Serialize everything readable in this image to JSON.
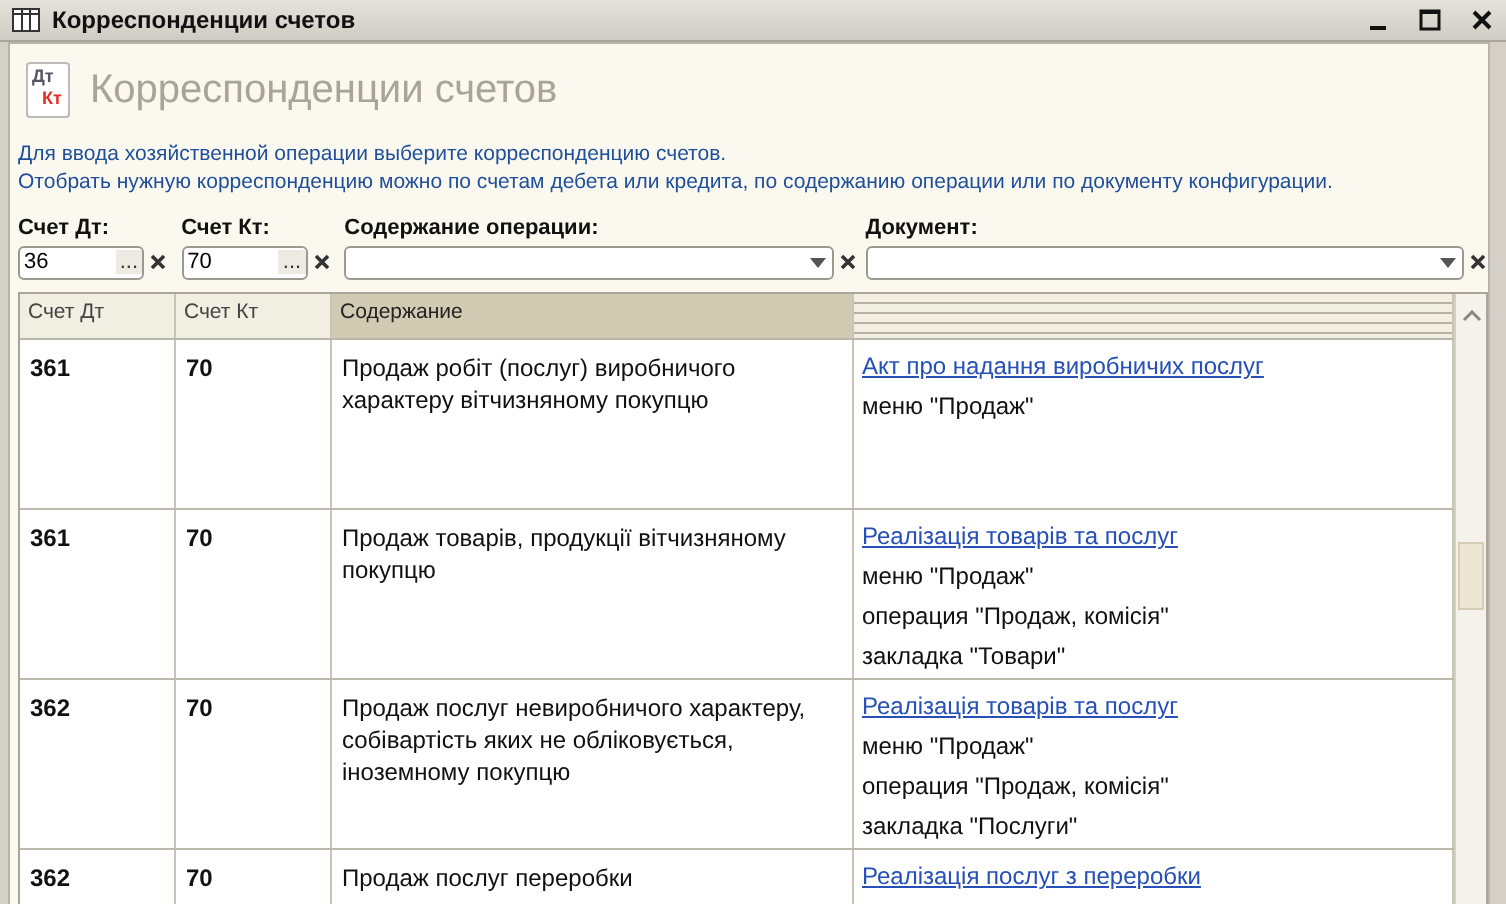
{
  "window": {
    "title": "Корреспонденции счетов"
  },
  "header": {
    "title": "Корреспонденции счетов",
    "icon_text_top": "Дт",
    "icon_text_bottom": "Кт"
  },
  "info": [
    "Для ввода хозяйственной операции выберите корреспонденцию счетов.",
    "Отобрать нужную корреспонденцию можно по счетам дебета или кредита, по содержанию операции или по документу конфигурации."
  ],
  "filters": [
    {
      "kind": "select",
      "label": "Счет Дт:",
      "value": "36",
      "button": "..."
    },
    {
      "kind": "select",
      "label": "Счет Кт:",
      "value": "70",
      "button": "..."
    },
    {
      "kind": "dropdown",
      "label": "Содержание операции:"
    },
    {
      "kind": "dropdown",
      "label": "Документ:"
    }
  ],
  "table": {
    "columns": [
      {
        "label": "Счет Дт",
        "selected": false
      },
      {
        "label": "Счет Кт",
        "selected": false
      },
      {
        "label": "Содержание",
        "selected": true
      }
    ],
    "rows": [
      {
        "dt": "361",
        "kt": "70",
        "content": "Продаж робіт (послуг) виробничого характеру вітчизняному покупцю",
        "document": "Акт про надання виробничих послуг",
        "notes": [
          "меню \"Продаж\""
        ]
      },
      {
        "dt": "361",
        "kt": "70",
        "content": "Продаж товарів, продукції вітчизняному покупцю",
        "document": "Реалізація товарів та послуг",
        "notes": [
          "меню \"Продаж\"",
          "операция \"Продаж, комісія\"",
          "закладка \"Товари\""
        ]
      },
      {
        "dt": "362",
        "kt": "70",
        "content": "Продаж послуг невиробничого характеру, собівартість яких не обліковується, іноземному покупцю",
        "document": "Реалізація товарів та послуг",
        "notes": [
          "меню \"Продаж\"",
          "операция \"Продаж, комісія\"",
          "закладка \"Послуги\""
        ]
      },
      {
        "dt": "362",
        "kt": "70",
        "content": "Продаж послуг переробки",
        "document": "Реалізація послуг з переробки",
        "notes": []
      }
    ]
  }
}
